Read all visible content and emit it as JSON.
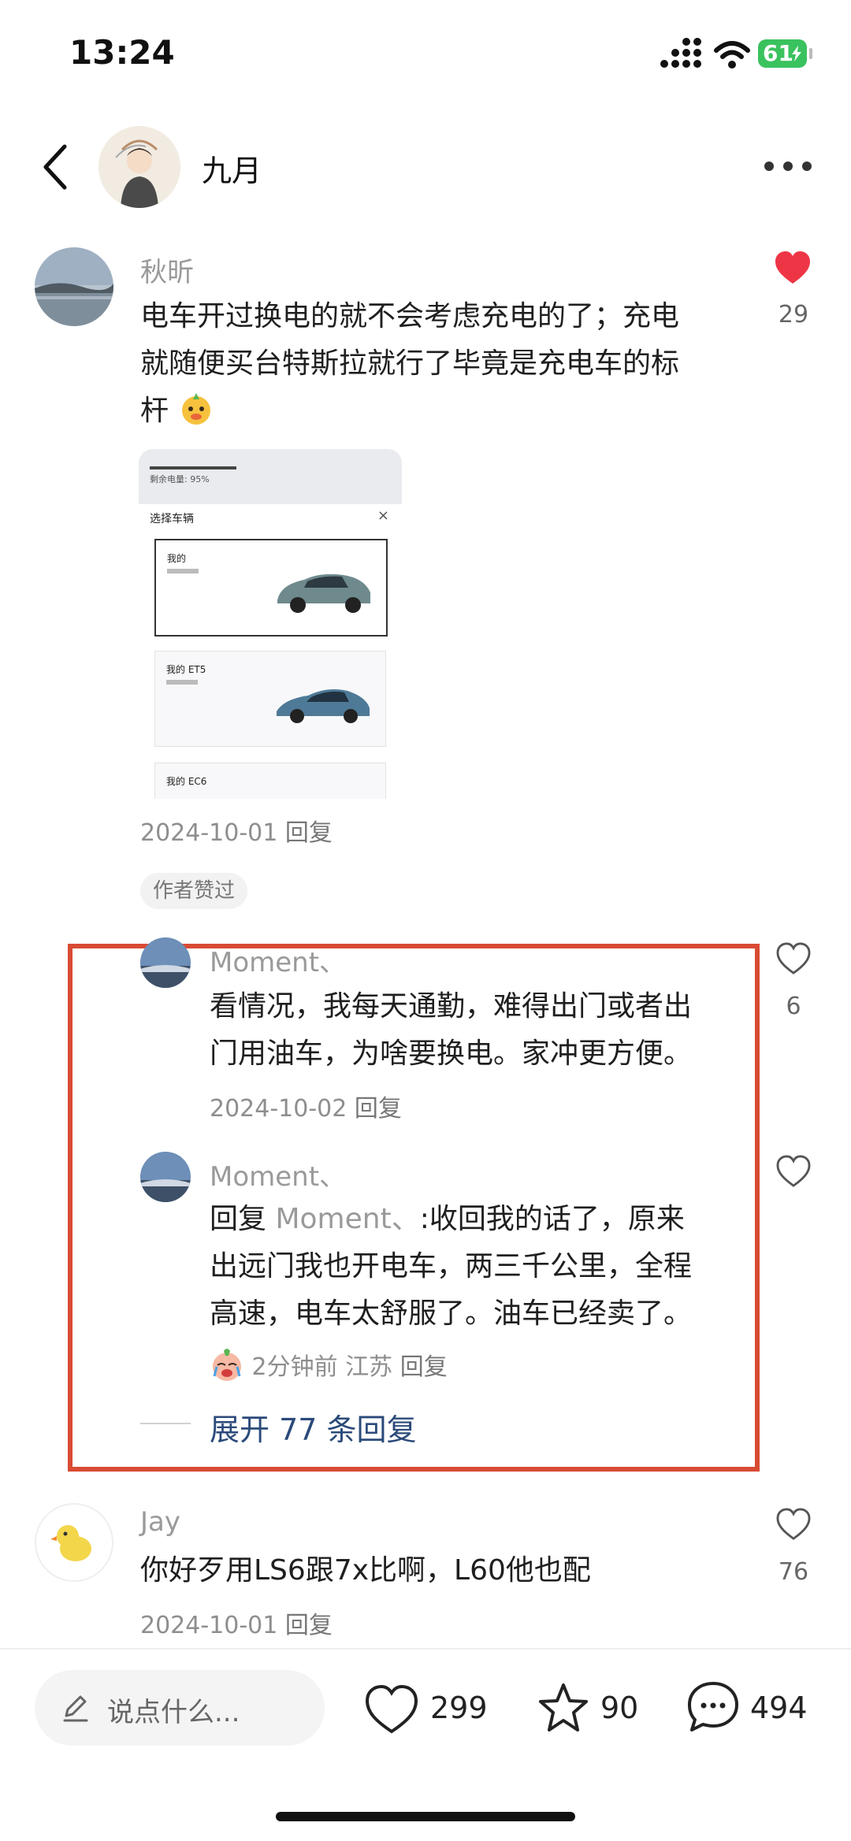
{
  "status_bar": {
    "time": "13:24",
    "battery": "61"
  },
  "header": {
    "title": "九月"
  },
  "comments": [
    {
      "user": "秋昕",
      "text_lines": [
        "电车开过换电的就不会考虑充电的了；充电",
        "就随便买台特斯拉就行了毕竟是充电车的标",
        "杆"
      ],
      "likes": "29",
      "liked": true,
      "date": "2024-10-01",
      "reply": "回复",
      "author_liked_tag": "作者赞过",
      "image": {
        "remaining_label": "剩余电量: 95%",
        "dialog_title": "选择车辆",
        "close": "×",
        "cards": [
          "我的",
          "我的 ET5",
          "我的 EC6"
        ]
      }
    },
    {
      "user": "Jay",
      "text": "你好歹用LS6跟7x比啊，L60他也配",
      "likes": "76",
      "date": "2024-10-01",
      "reply": "回复"
    }
  ],
  "replies": [
    {
      "user": "Moment、",
      "text_lines": [
        "看情况，我每天通勤，难得出门或者出",
        "门用油车，为啥要换电。家冲更方便。"
      ],
      "likes": "6",
      "date": "2024-10-02",
      "reply": "回复"
    },
    {
      "user": "Moment、",
      "reply_prefix": "回复",
      "reply_to": "Moment、",
      "reply_colon": ":",
      "text_lines": [
        "收回我的话了，原来",
        "出远门我也开电车，两三千公里，全程",
        "高速，电车太舒服了。油车已经卖了。"
      ],
      "time": "2分钟前",
      "location": "江苏",
      "reply": "回复"
    }
  ],
  "expand_replies": "展开 77 条回复",
  "bottom_bar": {
    "input_placeholder": "说点什么...",
    "likes": "299",
    "favorites": "90",
    "comments": "494"
  },
  "colors": {
    "like_red": "#ee3546",
    "highlight_box": "#d94b33",
    "link_blue": "#2b4a7a"
  },
  "icons": [
    "back-icon",
    "more-icon",
    "heart-icon",
    "star-icon",
    "comment-bubble-icon",
    "pen-icon",
    "emoji-icon"
  ]
}
